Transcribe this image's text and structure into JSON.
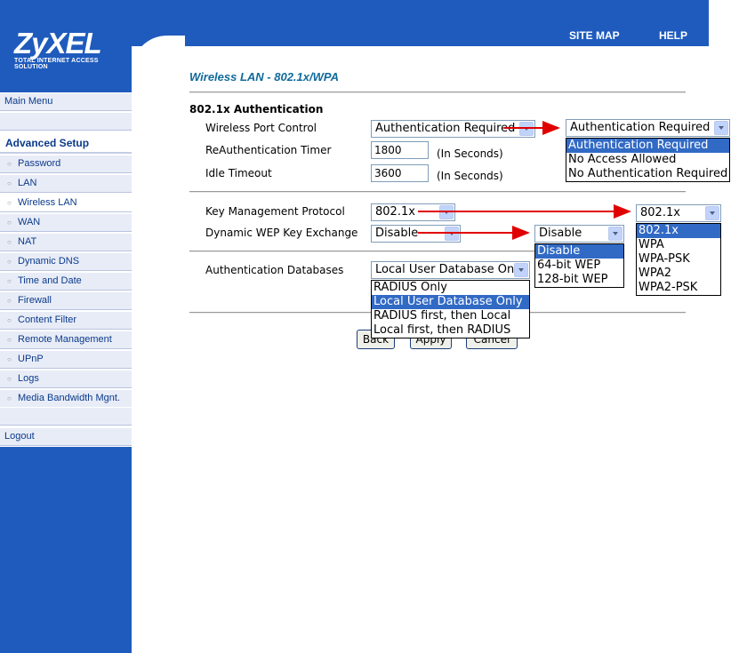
{
  "brand": {
    "logo_text": "ZyXEL",
    "tagline": "Total Internet Access Solution"
  },
  "header": {
    "site_map": "SITE MAP",
    "help": "HELP"
  },
  "menu": {
    "main_menu": "Main Menu",
    "advanced_setup": "Advanced Setup",
    "items": [
      "Password",
      "LAN",
      "Wireless LAN",
      "WAN",
      "NAT",
      "Dynamic DNS",
      "Time and Date",
      "Firewall",
      "Content Filter",
      "Remote Management",
      "UPnP",
      "Logs",
      "Media Bandwidth Mgnt."
    ],
    "selected": "Wireless LAN",
    "logout": "Logout"
  },
  "page": {
    "title": "Wireless LAN - 802.1x/WPA"
  },
  "auth": {
    "section_title": "802.1x Authentication",
    "wireless_port_control": {
      "label": "Wireless Port Control",
      "value": "Authentication Required",
      "options": [
        "Authentication Required",
        "No Access Allowed",
        "No Authentication Required"
      ],
      "highlighted": 0
    },
    "reauth_timer": {
      "label": "ReAuthentication Timer",
      "value": "1800",
      "unit": "(In Seconds)"
    },
    "idle_timeout": {
      "label": "Idle Timeout",
      "value": "3600",
      "unit": "(In Seconds)"
    }
  },
  "key": {
    "kmp": {
      "label": "Key Management Protocol",
      "value": "802.1x",
      "options": [
        "802.1x",
        "WPA",
        "WPA-PSK",
        "WPA2",
        "WPA2-PSK"
      ],
      "highlighted": 0
    },
    "wep": {
      "label": "Dynamic WEP Key Exchange",
      "value": "Disable",
      "options": [
        "Disable",
        "64-bit WEP",
        "128-bit WEP"
      ],
      "highlighted": 0
    }
  },
  "db": {
    "label": "Authentication Databases",
    "value": "Local User Database Only",
    "options": [
      "RADIUS Only",
      "Local User Database Only",
      "RADIUS first, then Local",
      "Local first, then RADIUS"
    ],
    "highlighted": 1
  },
  "buttons": {
    "back": "Back",
    "apply": "Apply",
    "cancel": "Cancel"
  },
  "colors": {
    "brand_blue": "#1f5bbd",
    "title_teal": "#106a9c",
    "highlight": "#316ac5",
    "arrow_red": "#e00000"
  }
}
